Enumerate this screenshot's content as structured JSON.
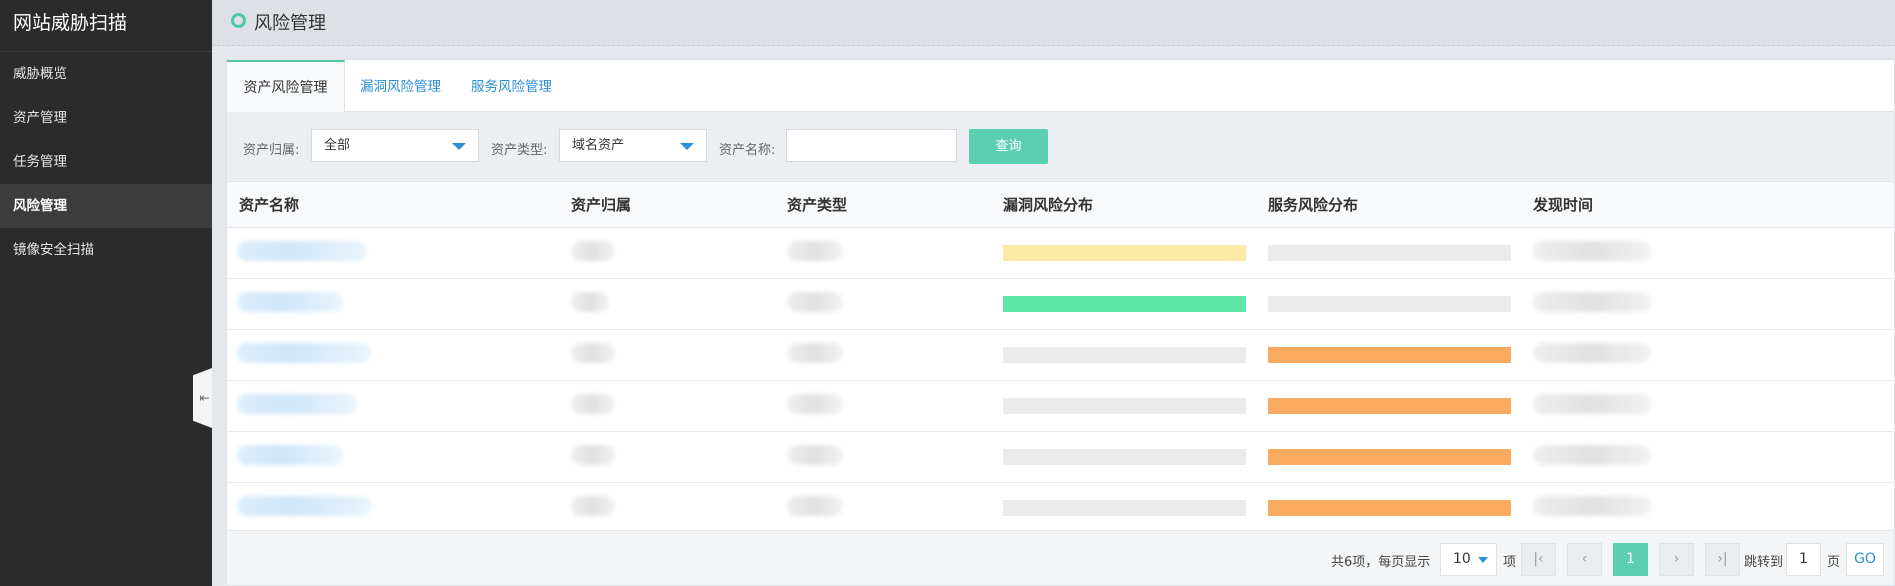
{
  "app": {
    "title": "网站威胁扫描"
  },
  "sidebar": {
    "items": [
      {
        "label": "威胁概览",
        "active": false
      },
      {
        "label": "资产管理",
        "active": false
      },
      {
        "label": "任务管理",
        "active": false
      },
      {
        "label": "风险管理",
        "active": true
      },
      {
        "label": "镜像安全扫描",
        "active": false
      }
    ],
    "collapse_icon": "collapse-left-icon"
  },
  "header": {
    "title": "风险管理"
  },
  "tabs": [
    {
      "label": "资产风险管理",
      "active": true
    },
    {
      "label": "漏洞风险管理",
      "active": false
    },
    {
      "label": "服务风险管理",
      "active": false
    }
  ],
  "filter": {
    "owner_label": "资产归属:",
    "owner_value": "全部",
    "type_label": "资产类型:",
    "type_value": "域名资产",
    "name_label": "资产名称:",
    "name_value": "",
    "query_label": "查询"
  },
  "table": {
    "headers": [
      "资产名称",
      "资产归属",
      "资产类型",
      "漏洞风险分布",
      "服务风险分布",
      "发现时间"
    ],
    "rows": [
      {
        "vuln_color": "#fde9a6",
        "service_color": "#ebebeb"
      },
      {
        "vuln_color": "#5ee6a6",
        "service_color": "#ebebeb"
      },
      {
        "vuln_color": "#ebebeb",
        "service_color": "#fbab60"
      },
      {
        "vuln_color": "#ebebeb",
        "service_color": "#fbab60"
      },
      {
        "vuln_color": "#ebebeb",
        "service_color": "#fbab60"
      },
      {
        "vuln_color": "#ebebeb",
        "service_color": "#fbab60"
      }
    ]
  },
  "pager": {
    "summary": "共6项，每页显示",
    "page_size": "10",
    "unit": "项",
    "first_icon": "first-page-icon",
    "prev_icon": "prev-page-icon",
    "current": "1",
    "next_icon": "next-page-icon",
    "last_icon": "last-page-icon",
    "jump_label": "跳转到",
    "jump_value": "1",
    "page_unit": "页",
    "go_label": "GO"
  }
}
